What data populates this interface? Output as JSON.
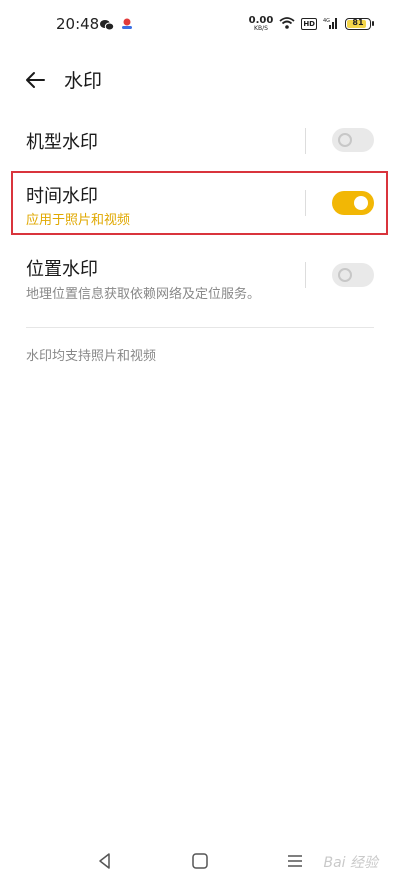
{
  "status_bar": {
    "time": "20:48",
    "net_speed_value": "0.00",
    "net_speed_unit": "KB/S",
    "hd_label": "HD",
    "signal_label": "4G",
    "battery_level": "81",
    "battery_fraction": 0.81
  },
  "header": {
    "title": "水印"
  },
  "settings": {
    "model_watermark": {
      "title": "机型水印",
      "enabled": false
    },
    "time_watermark": {
      "title": "时间水印",
      "subtitle": "应用于照片和视频",
      "enabled": true
    },
    "location_watermark": {
      "title": "位置水印",
      "subtitle": "地理位置信息获取依赖网络及定位服务。",
      "enabled": false
    }
  },
  "footer_note": "水印均支持照片和视频",
  "watermark_text": "Bai 经验",
  "colors": {
    "accent": "#f2b705",
    "accent_text": "#e0a800",
    "highlight_border": "#d9343c",
    "toggle_off": "#e9e9e9"
  }
}
